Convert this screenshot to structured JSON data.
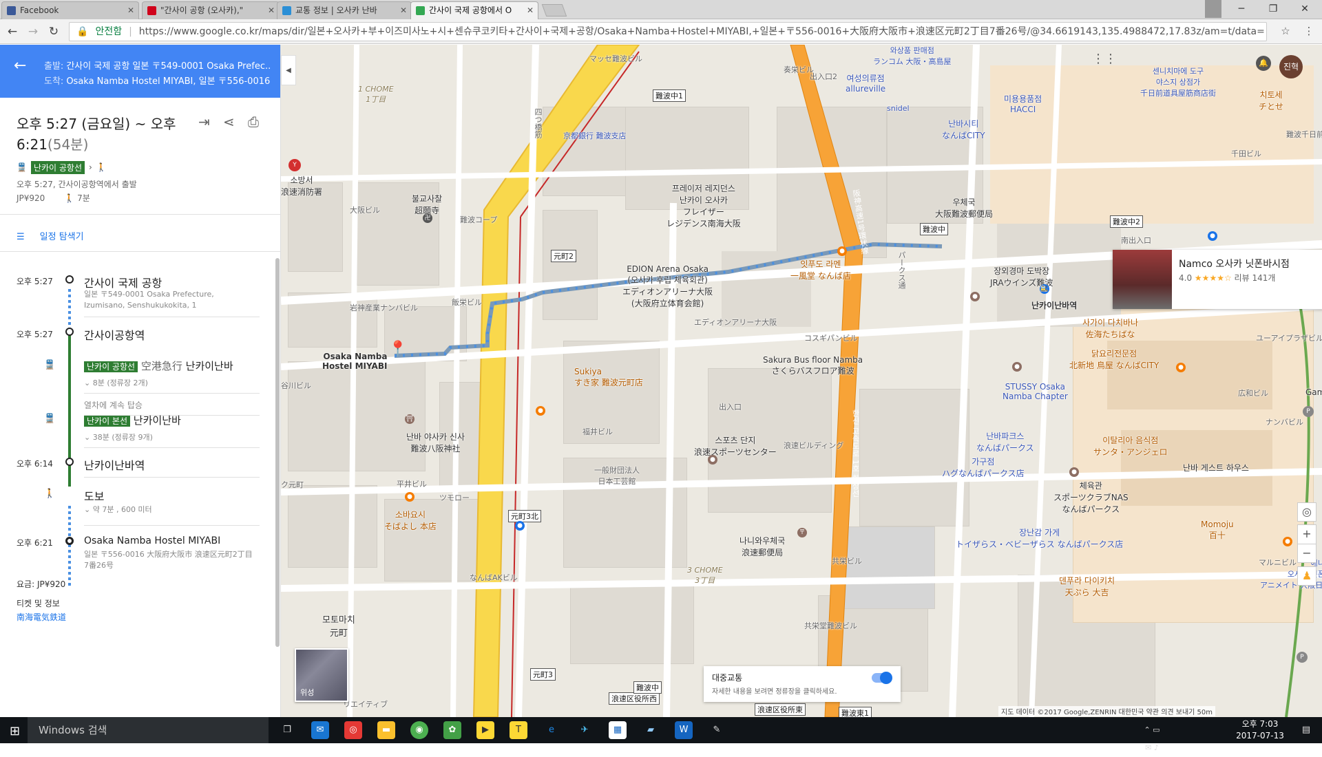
{
  "browser": {
    "tabs": [
      {
        "title": "Facebook",
        "color": "#3b5998"
      },
      {
        "title": "\"간사이 공항 (오사카),\"",
        "color": "#d0021b"
      },
      {
        "title": "교통 정보 | 오사카 난바",
        "color": "#2b8fd6"
      },
      {
        "title": "간사이 국제 공항에서 O",
        "color": "#34a853"
      }
    ],
    "secure_label": "안전함",
    "url": "https://www.google.co.kr/maps/dir/일본+오사카+부+이즈미사노+시+센슈쿠코키타+간사이+국제+공항/Osaka+Namba+Hostel+MIYABI,+일본+〒556-0016+大阪府大阪市+浪速区元町2丁目7番26号/@34.6619143,135.4988472,17.83z/am=t/data=!4m18!4m17!1m"
  },
  "directions": {
    "from_prefix": "출발:",
    "from": "간사이 국제 공항 일본 〒549-0001 Osaka Prefec...",
    "to_prefix": "도착:",
    "to": "Osaka Namba Hostel MIYABI, 일본 〒556-0016 ...",
    "time_range": "오후 5:27 (금요일) ~ 오후 6:21",
    "duration": "(54분)",
    "line_tag": "난카이 공항선",
    "depart_note": "오후 5:27, 간사이공항역에서 출발",
    "fare": "JP¥920",
    "walk": "7분",
    "explorer": "일정 탐색기"
  },
  "timeline": [
    {
      "time": "오후 5:27",
      "name": "간사이 국제 공항",
      "sub": "일본 〒549-0001 Osaka Prefecture, Izumisano, Senshukukokita, 1"
    },
    {
      "time": "오후 5:27",
      "name": "간사이공항역"
    },
    {
      "line": "난카이 공항선",
      "dest_jp": "空港急行",
      "dest": "난카이난바",
      "stops": "8분 (정류장 2개)"
    },
    {
      "note": "열차에 계속 탑승"
    },
    {
      "line": "난카이 본선",
      "dest": "난카이난바",
      "stops": "38분 (정류장 9개)"
    },
    {
      "time": "오후 6:14",
      "name": "난카이난바역"
    },
    {
      "name": "도보",
      "sub": "약 7분 , 600 미터"
    },
    {
      "time": "오후 6:21",
      "name": "Osaka Namba Hostel MIYABI",
      "sub": "일본 〒556-0016 大阪府大阪市 浪速区元町2丁目7番26号"
    }
  ],
  "fare_line": "요금: JP¥920",
  "ticket_label": "티켓 및 정보",
  "ticket_link": "南海電気鉄道",
  "map": {
    "labels": [
      "Osaka Namba",
      "Hostel MIYABI",
      "EDION Arena Osaka",
      "(오사카 후립 체육회관)",
      "エディオンアリーナ大阪",
      "(大阪府立体育会館)",
      "Sakura Bus floor Namba",
      "さくらバスフロア難波",
      "스포츠 단지",
      "浪速スポーツセンター",
      "난바 야사카 신사",
      "難波八阪神社",
      "Sukiya",
      "すき家 難波元町店",
      "나니와우체국",
      "浪速郵便局",
      "장외경마 도박장",
      "JRAウインズ難波",
      "난카이난바역",
      "사가이 다치바나",
      "佐海たちばな",
      "닭요리전문점",
      "北新地 鳥屋 なんばCITY",
      "STUSSY Osaka",
      "Namba Chapter",
      "난바파크스",
      "なんばパークス",
      "가구점",
      "ハグなんばパークス店",
      "체육관",
      "スポーツクラブNAS",
      "なんばパークス",
      "장난감 가게",
      "トイザらス・ベビーザらス なんばパークス店",
      "이탈리아 음식점",
      "サンタ・アンジェロ",
      "난바 게스트 하우스",
      "Momoju",
      "百十",
      "덴푸라 다이키치",
      "天ぷら 大吉",
      "애니메이트",
      "오사카 닛폰바시점",
      "アニメイト 大阪日本橋店",
      "프레이저 레지던스",
      "난카이 오사카",
      "フレイザー",
      "レジデンス南海大阪",
      "잇푸도 라멘",
      "一風堂 なんば店",
      "소바요시",
      "そばよし 本店",
      "불교사찰",
      "超願寺",
      "소방서",
      "浪速消防署",
      "모토마치",
      "元町",
      "와상품 판매점",
      "ランコム 大阪・高島屋",
      "여성의류점",
      "allureville",
      "snidel",
      "미용용품점",
      "HACCI",
      "난바시티",
      "なんばCITY",
      "센니치마에 도구",
      "야스지 상점가",
      "千日前道具屋筋商店街",
      "치토세",
      "チとせ",
      "우체국",
      "大阪難波郵便局",
      "Gamers N",
      "1 CHOME",
      "1丁目",
      "3 CHOME",
      "3丁目",
      "四つ橋筋",
      "京都銀行 難波支店",
      "阪神高速1号環状線",
      "한신 고속도로 1호 환상선",
      "パークス通",
      "一般財団法人",
      "日本工芸館",
      "エディオンアリーナ大阪",
      "コスギパンビル",
      "出入口",
      "出入口2",
      "浪速ビルディング",
      "共栄ビル",
      "共栄町",
      "マルニビル",
      "ユーアイプラザビル",
      "広和ビル",
      "ナンバビル",
      "南出入口",
      "千田ビル",
      "難波千日前",
      "岩神産業ナンバビル",
      "飯栄ビル",
      "平井ビル",
      "ツモロー",
      "福井ビル",
      "大阪ビル",
      "難波コープ",
      "なんばAKビル",
      "共栄堂難波ビル",
      "マッセ難波ビル",
      "奏栄ビル",
      "谷川ビル",
      "ク元町",
      "リエイティブ",
      "パークス通り"
    ],
    "road_signs": [
      "難波中1",
      "元町2",
      "元町3北",
      "元町3",
      "難波中",
      "難波中2",
      "浪速区役所西",
      "浪速区役所東",
      "難波中",
      "難波東1"
    ],
    "place_card": {
      "name": "Namco 오사카 닛폰바시점",
      "rating": "4.0",
      "stars": "★★★★☆",
      "reviews": "리뷰 141개"
    },
    "transit_panel": {
      "title": "대중교통",
      "desc": "자세한 내용을 보려면 정류장을 클릭하세요."
    },
    "sat_label": "위성",
    "footer": "지도 데이터 ©2017 Google,ZENRIN  대한민국  약관  의견 보내기  50m",
    "user_initials": "진혁"
  },
  "taskbar": {
    "search": "Windows 검색",
    "time": "오후 7:03",
    "date": "2017-07-13"
  }
}
